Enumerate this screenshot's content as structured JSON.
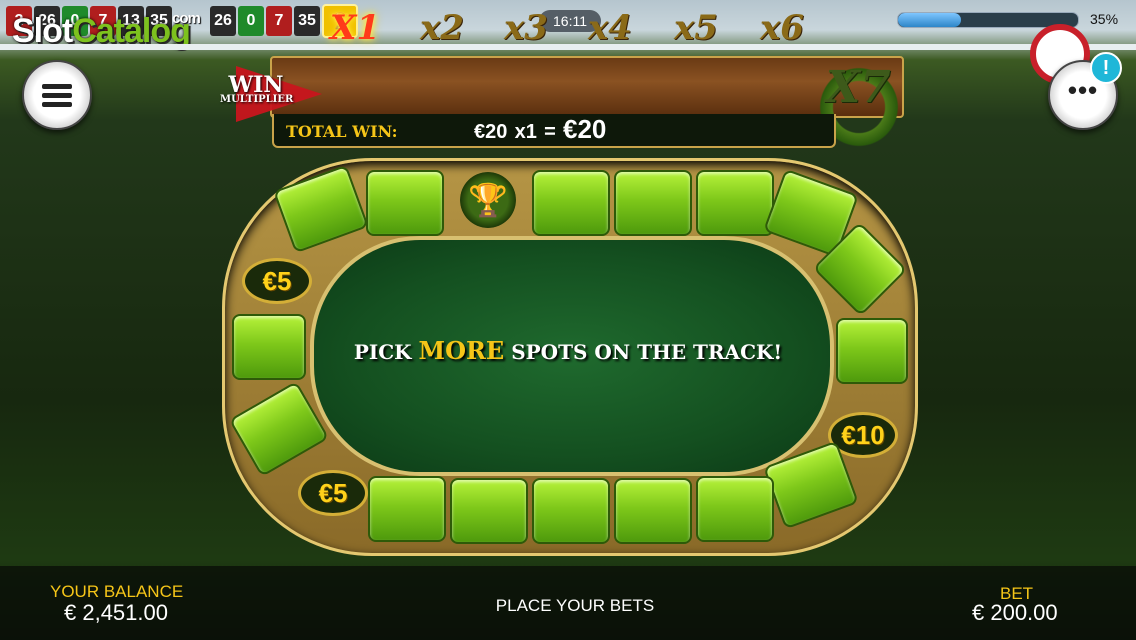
{
  "history": [
    "2",
    "26",
    "0",
    "7",
    "13",
    "35",
    "26",
    "0",
    "7",
    "35"
  ],
  "history_colors": [
    "red",
    "black",
    "green",
    "red",
    "black",
    "black",
    "black",
    "green",
    "red",
    "black"
  ],
  "logo": {
    "part1": "Slot",
    "part2": "Catalog",
    "suffix": "com"
  },
  "clock": "16:11",
  "progress": {
    "value": 0.35,
    "label": "35%"
  },
  "win_multiplier": {
    "win": "WIN",
    "multiplier": "MULTIPLIER",
    "values": [
      "X1",
      "x2",
      "x3",
      "x4",
      "x5",
      "x6",
      "X7"
    ],
    "active": "X1"
  },
  "total_win": {
    "label": "TOTAL WIN:",
    "amount": "€20",
    "mult": "x1",
    "equals": "=",
    "result": "€20"
  },
  "track": {
    "message_pre": "PICK",
    "message_more": "MORE",
    "message_post": "SPOTS ON THE TRACK!",
    "coins": [
      "€5",
      "€10",
      "€5"
    ]
  },
  "footer": {
    "balance_label": "YOUR BALANCE",
    "balance_value": "€ 2,451.00",
    "status": "PLACE YOUR BETS",
    "bet_label": "BET",
    "bet_value": "€ 200.00"
  },
  "icons": [
    "menu-icon",
    "more-icon",
    "notification-icon",
    "trophy-icon",
    "flag-icon"
  ]
}
